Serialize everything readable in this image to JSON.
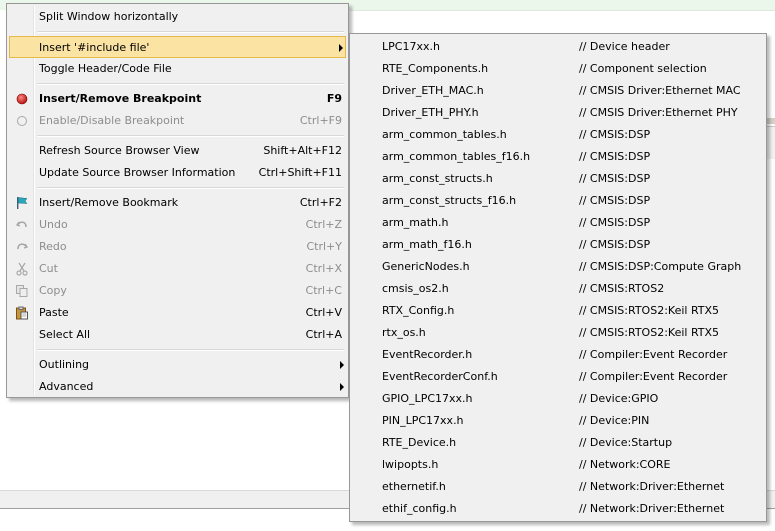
{
  "context_menu": {
    "items": [
      {
        "label": "Split Window horizontally",
        "shortcut": ""
      },
      {
        "label": "Insert '#include file'",
        "shortcut": ""
      },
      {
        "label": "Toggle Header/Code File",
        "shortcut": ""
      },
      {
        "label": "Insert/Remove Breakpoint",
        "shortcut": "F9"
      },
      {
        "label": "Enable/Disable Breakpoint",
        "shortcut": "Ctrl+F9"
      },
      {
        "label": "Refresh Source Browser View",
        "shortcut": "Shift+Alt+F12"
      },
      {
        "label": "Update Source Browser Information",
        "shortcut": "Ctrl+Shift+F11"
      },
      {
        "label": "Insert/Remove Bookmark",
        "shortcut": "Ctrl+F2"
      },
      {
        "label": "Undo",
        "shortcut": "Ctrl+Z"
      },
      {
        "label": "Redo",
        "shortcut": "Ctrl+Y"
      },
      {
        "label": "Cut",
        "shortcut": "Ctrl+X"
      },
      {
        "label": "Copy",
        "shortcut": "Ctrl+C"
      },
      {
        "label": "Paste",
        "shortcut": "Ctrl+V"
      },
      {
        "label": "Select All",
        "shortcut": "Ctrl+A"
      },
      {
        "label": "Outlining",
        "shortcut": ""
      },
      {
        "label": "Advanced",
        "shortcut": ""
      }
    ]
  },
  "include_submenu": {
    "items": [
      {
        "file": "LPC17xx.h",
        "comment": "// Device header"
      },
      {
        "file": "RTE_Components.h",
        "comment": "// Component selection"
      },
      {
        "file": "Driver_ETH_MAC.h",
        "comment": "// CMSIS Driver:Ethernet MAC"
      },
      {
        "file": "Driver_ETH_PHY.h",
        "comment": "// CMSIS Driver:Ethernet PHY"
      },
      {
        "file": "arm_common_tables.h",
        "comment": "// CMSIS:DSP"
      },
      {
        "file": "arm_common_tables_f16.h",
        "comment": "// CMSIS:DSP"
      },
      {
        "file": "arm_const_structs.h",
        "comment": "// CMSIS:DSP"
      },
      {
        "file": "arm_const_structs_f16.h",
        "comment": "// CMSIS:DSP"
      },
      {
        "file": "arm_math.h",
        "comment": "// CMSIS:DSP"
      },
      {
        "file": "arm_math_f16.h",
        "comment": "// CMSIS:DSP"
      },
      {
        "file": "GenericNodes.h",
        "comment": "// CMSIS:DSP:Compute Graph"
      },
      {
        "file": "cmsis_os2.h",
        "comment": "// CMSIS:RTOS2"
      },
      {
        "file": "RTX_Config.h",
        "comment": "// CMSIS:RTOS2:Keil RTX5"
      },
      {
        "file": "rtx_os.h",
        "comment": "// CMSIS:RTOS2:Keil RTX5"
      },
      {
        "file": "EventRecorder.h",
        "comment": "// Compiler:Event Recorder"
      },
      {
        "file": "EventRecorderConf.h",
        "comment": "// Compiler:Event Recorder"
      },
      {
        "file": "GPIO_LPC17xx.h",
        "comment": "// Device:GPIO"
      },
      {
        "file": "PIN_LPC17xx.h",
        "comment": "// Device:PIN"
      },
      {
        "file": "RTE_Device.h",
        "comment": "// Device:Startup"
      },
      {
        "file": "lwipopts.h",
        "comment": "// Network:CORE"
      },
      {
        "file": "ethernetif.h",
        "comment": "// Network:Driver:Ethernet"
      },
      {
        "file": "ethif_config.h",
        "comment": "// Network:Driver:Ethernet"
      }
    ]
  },
  "icons": {
    "breakpoint": "breakpoint-icon",
    "breakpoint_disabled": "breakpoint-disabled-icon",
    "bookmark": "bookmark-icon",
    "undo": "undo-icon",
    "redo": "redo-icon",
    "cut": "cut-icon",
    "copy": "copy-icon",
    "paste": "paste-icon"
  }
}
